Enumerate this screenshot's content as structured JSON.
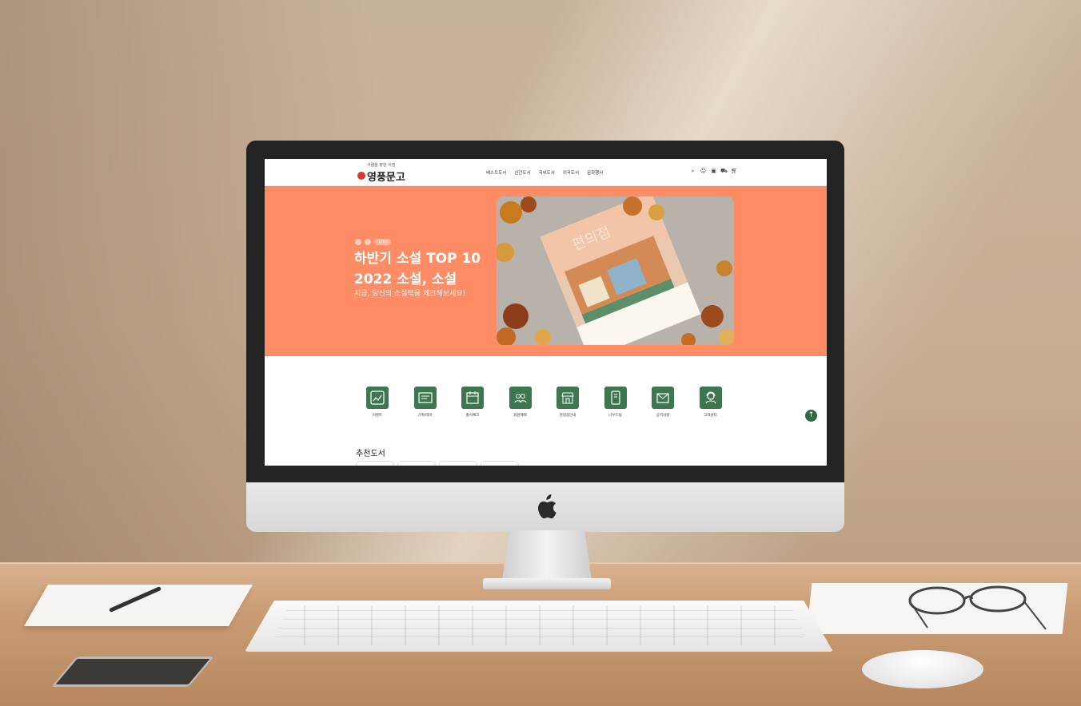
{
  "site": {
    "logo_slogan": "사람을 향한 서점",
    "logo_text": "영풍문고",
    "nav": [
      "베스트도서",
      "신간도서",
      "국내도서",
      "외국도서",
      "문화행사"
    ],
    "header_icons": [
      "search-icon",
      "user-icon",
      "lock-icon",
      "truck-icon",
      "cart-icon"
    ]
  },
  "hero": {
    "pill": "1/10",
    "title_line1": "하반기 소설 TOP 10",
    "title_line2": "2022 소설, 소설",
    "subtitle": "지금, 당신의 소설력을 체크해보세요!",
    "image": "autumn-novel-book-cover-with-leaves"
  },
  "categories": [
    {
      "label": "이벤트",
      "icon": "event-icon"
    },
    {
      "label": "기획/테마",
      "icon": "theme-icon"
    },
    {
      "label": "출석체크",
      "icon": "calendar-icon"
    },
    {
      "label": "회원혜택",
      "icon": "members-icon"
    },
    {
      "label": "영업점안내",
      "icon": "store-icon"
    },
    {
      "label": "나우드림",
      "icon": "phone-book-icon"
    },
    {
      "label": "공지사항",
      "icon": "mail-icon"
    },
    {
      "label": "고객센터",
      "icon": "support-icon"
    }
  ],
  "section": {
    "title": "추천도서"
  },
  "colors": {
    "hero_bg": "#ff8c64",
    "accent_green": "#3e7650",
    "logo_red": "#d83a2e"
  }
}
